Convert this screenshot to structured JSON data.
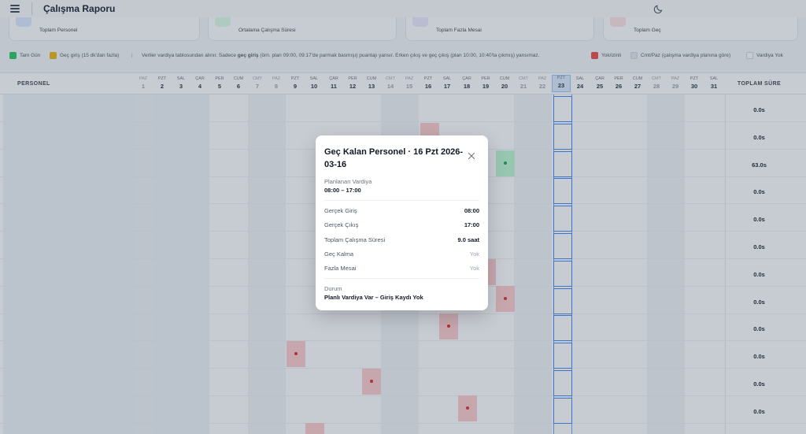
{
  "header": {
    "title": "Çalışma Raporu"
  },
  "stats": [
    {
      "label": "Toplam Personel",
      "icon": "users-icon",
      "color": "#dbeafe"
    },
    {
      "label": "Ortalama Çalışma Süresi",
      "icon": "clock-icon",
      "color": "#dcfce7"
    },
    {
      "label": "Toplam Fazla Mesai",
      "icon": "trend-icon",
      "color": "#ede9fe"
    },
    {
      "label": "Toplam Geç",
      "icon": "calendar-icon",
      "color": "#fee2e2"
    }
  ],
  "legend": {
    "full_day": "Tam Gün",
    "late": "Geç giriş (15 dk'dan fazla)",
    "note_pre": "Veriler vardiya tablosundan alınır. Sadece",
    "note_bold": "geç giriş",
    "note_post": "(örn. plan 09:00, 09:17'de parmak basmışı) puantajı yansır. Erken çıkış ve geç çıkış (plan 10:00, 10:40'ta çıkmış) yansımaz.",
    "absent": "Yok/izinli",
    "weekend": "Cmt/Paz (çalışma vardiya planına göre)",
    "no_shift": "Vardiya Yok",
    "colors": {
      "full_day": "#22c55e",
      "late": "#eab308",
      "absent": "#ef4444"
    }
  },
  "table": {
    "name_header": "PERSONEL",
    "total_header": "TOPLAM SÜRE",
    "days": [
      {
        "d": "PAZ",
        "n": "1"
      },
      {
        "d": "PZT",
        "n": "2"
      },
      {
        "d": "SAL",
        "n": "3"
      },
      {
        "d": "ÇAR",
        "n": "4"
      },
      {
        "d": "PER",
        "n": "5"
      },
      {
        "d": "CUM",
        "n": "6"
      },
      {
        "d": "CMT",
        "n": "7"
      },
      {
        "d": "PAZ",
        "n": "8"
      },
      {
        "d": "PZT",
        "n": "9"
      },
      {
        "d": "SAL",
        "n": "10"
      },
      {
        "d": "ÇAR",
        "n": "11"
      },
      {
        "d": "PER",
        "n": "12"
      },
      {
        "d": "CUM",
        "n": "13"
      },
      {
        "d": "CMT",
        "n": "14"
      },
      {
        "d": "PAZ",
        "n": "15"
      },
      {
        "d": "PZT",
        "n": "16"
      },
      {
        "d": "SAL",
        "n": "17"
      },
      {
        "d": "ÇAR",
        "n": "18"
      },
      {
        "d": "PER",
        "n": "19"
      },
      {
        "d": "CUM",
        "n": "20"
      },
      {
        "d": "CMT",
        "n": "21"
      },
      {
        "d": "PAZ",
        "n": "22"
      },
      {
        "d": "PZT",
        "n": "23"
      },
      {
        "d": "SAL",
        "n": "24"
      },
      {
        "d": "ÇAR",
        "n": "25"
      },
      {
        "d": "PER",
        "n": "26"
      },
      {
        "d": "CUM",
        "n": "27"
      },
      {
        "d": "CMT",
        "n": "28"
      },
      {
        "d": "PAZ",
        "n": "29"
      },
      {
        "d": "PZT",
        "n": "30"
      },
      {
        "d": "SAL",
        "n": "31"
      }
    ],
    "totals": [
      "0.0s",
      "0.0s",
      "63.0s",
      "0.0s",
      "0.0s",
      "0.0s",
      "0.0s",
      "0.0s",
      "0.0s",
      "0.0s",
      "0.0s",
      "0.0s"
    ]
  },
  "modal": {
    "title": "Geç Kalan Personel · 16 Pzt 2026-03-16",
    "planned_label": "Planlanan Vardiya",
    "planned_value": "08:00 – 17:00",
    "rows": [
      {
        "label": "Gerçek Giriş",
        "value": "08:00"
      },
      {
        "label": "Gerçek Çıkış",
        "value": "17:00"
      },
      {
        "label": "Toplam Çalışma Süresi",
        "value": "9.0 saat"
      },
      {
        "label": "Geç Kalma",
        "value": "Yok"
      },
      {
        "label": "Fazla Mesai",
        "value": "Yok"
      }
    ],
    "status_label": "Durum",
    "status_value": "Planlı Vardiya Var – Giriş Kaydı Yok"
  }
}
